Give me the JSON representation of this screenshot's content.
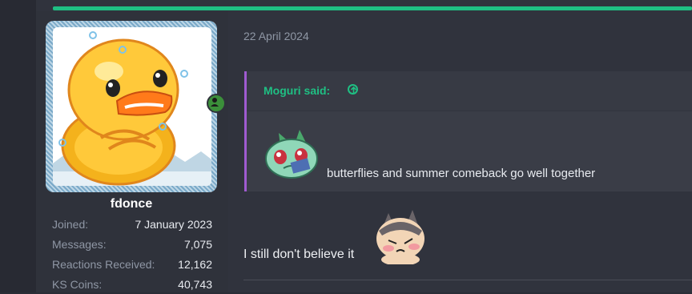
{
  "user": {
    "name": "fdonce",
    "stats": [
      {
        "label": "Joined:",
        "value": "7 January 2023"
      },
      {
        "label": "Messages:",
        "value": "7,075"
      },
      {
        "label": "Reactions Received:",
        "value": "12,162"
      },
      {
        "label": "KS Coins:",
        "value": "40,743"
      }
    ]
  },
  "post": {
    "date": "22 April 2024",
    "quote": {
      "author_label": "Moguri said:",
      "text": "butterflies and summer comeback go well together"
    },
    "body": "I still don't believe it"
  },
  "colors": {
    "accent": "#1fbf83",
    "quote_border": "#a05bd1",
    "background": "#30333d"
  }
}
